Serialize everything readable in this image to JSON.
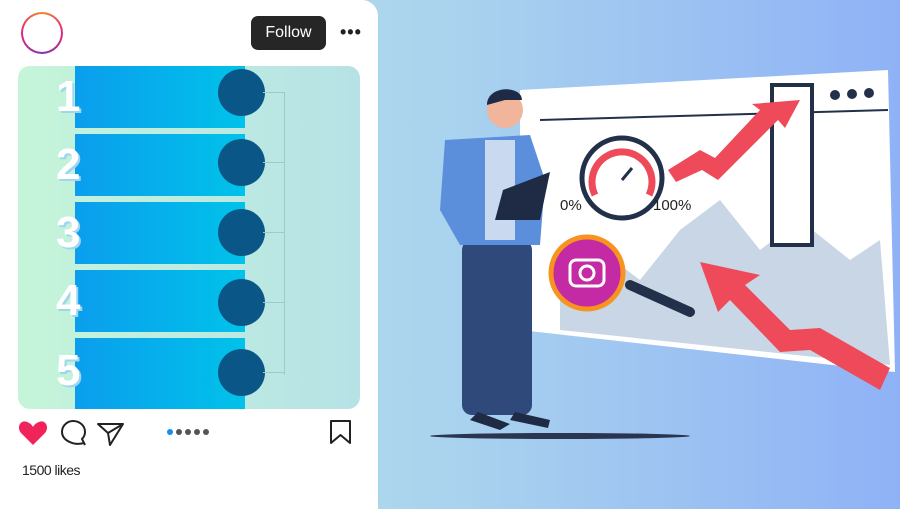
{
  "post": {
    "follow_label": "Follow",
    "more_icon": "more-horizontal-icon",
    "steps": [
      "1",
      "2",
      "3",
      "4",
      "5"
    ],
    "carousel": {
      "pages": 5,
      "active": 1
    },
    "likes": "1500 likes",
    "colors": {
      "like": "#f0245a",
      "follow_bg": "#262626",
      "step": "#0b9eed",
      "circle": "#0a5686",
      "active_dot": "#1a8cf0"
    }
  },
  "illustration": {
    "gauge_min": "0%",
    "gauge_max": "100%",
    "colors": {
      "arrow": "#ee4a5a",
      "board": "#ffffff"
    }
  }
}
